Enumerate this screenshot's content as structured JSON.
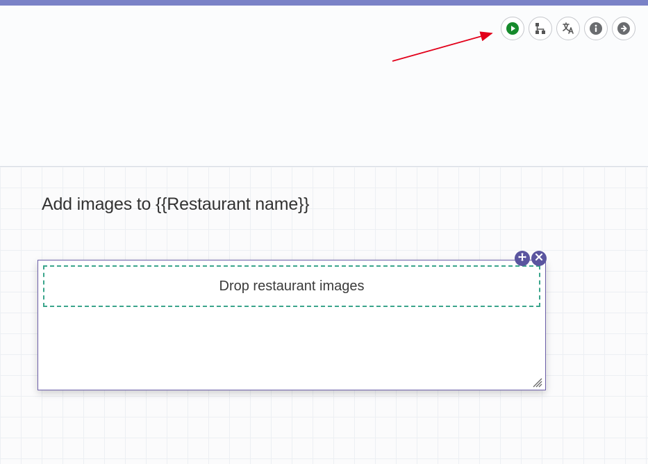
{
  "icons": {
    "play": "play-icon",
    "hierarchy": "hierarchy-icon",
    "translate": "translate-icon",
    "info": "info-icon",
    "next": "arrow-right-circle-icon",
    "move": "move-icon",
    "close": "close-icon"
  },
  "page": {
    "title": "Add images to {{Restaurant name}}"
  },
  "dropzone": {
    "label": "Drop restaurant images"
  },
  "annotation_arrow": {
    "color": "#e2001a"
  }
}
